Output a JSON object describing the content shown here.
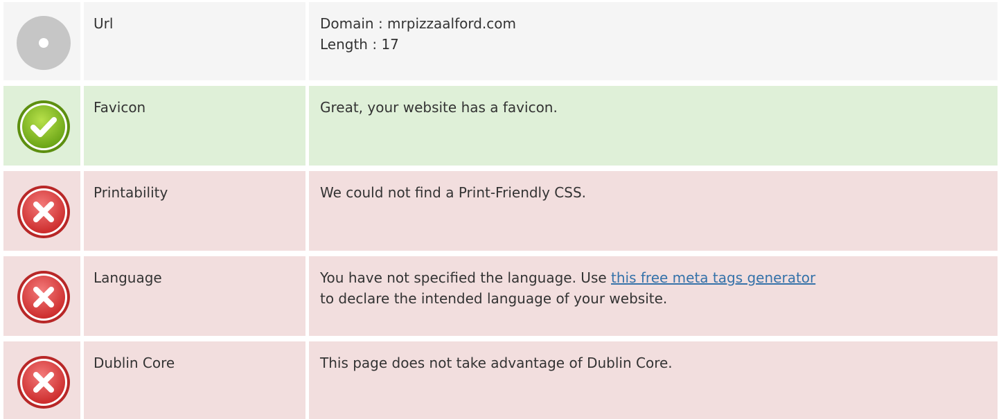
{
  "rows": [
    {
      "status": "neutral",
      "icon": "neutral-circle-icon",
      "label": "Url",
      "value_lines": [
        "Domain : mrpizzaalford.com",
        "Length : 17"
      ]
    },
    {
      "status": "pass",
      "icon": "check-icon",
      "label": "Favicon",
      "value": "Great, your website has a favicon."
    },
    {
      "status": "fail",
      "icon": "error-x-icon",
      "label": "Printability",
      "value": "We could not find a Print-Friendly CSS."
    },
    {
      "status": "fail",
      "icon": "error-x-icon",
      "label": "Language",
      "value_before_link": "You have not specified the language. Use ",
      "link_text": "this free meta tags generator",
      "value_after_link": "to declare the intended language of your website."
    },
    {
      "status": "fail",
      "icon": "error-x-icon",
      "label": "Dublin Core",
      "value": "This page does not take advantage of Dublin Core."
    }
  ],
  "colors": {
    "neutral_bg": "#f5f5f5",
    "pass_bg": "#dff0d8",
    "fail_bg": "#f2dede",
    "link": "#3572a9",
    "text": "#333333"
  }
}
